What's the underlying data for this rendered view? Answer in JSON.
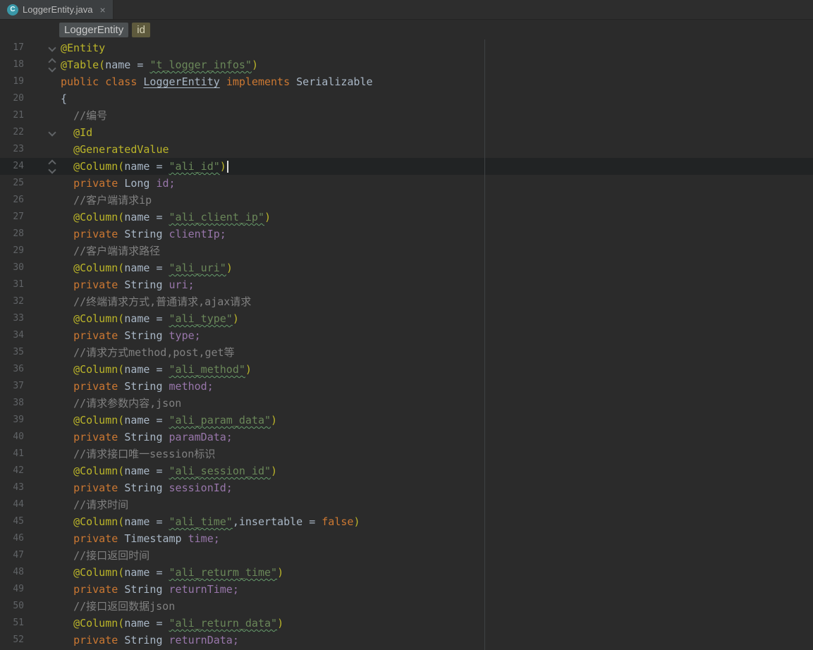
{
  "tab_bar": {
    "tabs": [
      {
        "title": "LoggerEntity.java",
        "icon": "java-class-icon",
        "icon_letter": "C",
        "close_glyph": "×",
        "active": true
      }
    ]
  },
  "breadcrumbs": {
    "items": [
      {
        "label": "LoggerEntity",
        "variant": "default"
      },
      {
        "label": "id",
        "variant": "highlight"
      }
    ]
  },
  "editor": {
    "language": "java",
    "current_line": 24,
    "margin_column_x": 687,
    "lines": [
      {
        "num": 17,
        "indent": 0,
        "fold": "chevron-down",
        "tokens": [
          [
            "ann",
            "@Entity"
          ]
        ]
      },
      {
        "num": 18,
        "indent": 0,
        "fold": "chevron-updown",
        "tokens": [
          [
            "ann",
            "@Table("
          ],
          [
            "plain",
            "name = "
          ],
          [
            "str",
            "\"t_logger_infos\""
          ],
          [
            "ann",
            ")"
          ]
        ]
      },
      {
        "num": 19,
        "indent": 0,
        "fold": null,
        "tokens": [
          [
            "kw",
            "public class "
          ],
          [
            "clsdecl",
            "LoggerEntity"
          ],
          [
            "plain",
            " "
          ],
          [
            "kw",
            "implements "
          ],
          [
            "plain",
            "Serializable"
          ]
        ]
      },
      {
        "num": 20,
        "indent": 0,
        "fold": null,
        "tokens": [
          [
            "plain",
            "{"
          ]
        ]
      },
      {
        "num": 21,
        "indent": 1,
        "fold": null,
        "tokens": [
          [
            "cmt",
            "//编号"
          ]
        ]
      },
      {
        "num": 22,
        "indent": 1,
        "fold": "chevron-down",
        "tokens": [
          [
            "ann",
            "@Id"
          ]
        ]
      },
      {
        "num": 23,
        "indent": 1,
        "fold": null,
        "tokens": [
          [
            "ann",
            "@GeneratedValue"
          ]
        ]
      },
      {
        "num": 24,
        "indent": 1,
        "fold": "chevron-updown",
        "caret": true,
        "tokens": [
          [
            "ann",
            "@Column("
          ],
          [
            "plain",
            "name = "
          ],
          [
            "str",
            "\"ali_id\""
          ],
          [
            "ann",
            ")"
          ]
        ]
      },
      {
        "num": 25,
        "indent": 1,
        "fold": null,
        "tokens": [
          [
            "kw",
            "private "
          ],
          [
            "plain",
            "Long "
          ],
          [
            "field",
            "id;"
          ]
        ]
      },
      {
        "num": 26,
        "indent": 1,
        "fold": null,
        "tokens": [
          [
            "cmt",
            "//客户端请求ip"
          ]
        ]
      },
      {
        "num": 27,
        "indent": 1,
        "fold": null,
        "tokens": [
          [
            "ann",
            "@Column("
          ],
          [
            "plain",
            "name = "
          ],
          [
            "str",
            "\"ali_client_ip\""
          ],
          [
            "ann",
            ")"
          ]
        ]
      },
      {
        "num": 28,
        "indent": 1,
        "fold": null,
        "tokens": [
          [
            "kw",
            "private "
          ],
          [
            "plain",
            "String "
          ],
          [
            "field",
            "clientIp;"
          ]
        ]
      },
      {
        "num": 29,
        "indent": 1,
        "fold": null,
        "tokens": [
          [
            "cmt",
            "//客户端请求路径"
          ]
        ]
      },
      {
        "num": 30,
        "indent": 1,
        "fold": null,
        "tokens": [
          [
            "ann",
            "@Column("
          ],
          [
            "plain",
            "name = "
          ],
          [
            "str",
            "\"ali_uri\""
          ],
          [
            "ann",
            ")"
          ]
        ]
      },
      {
        "num": 31,
        "indent": 1,
        "fold": null,
        "tokens": [
          [
            "kw",
            "private "
          ],
          [
            "plain",
            "String "
          ],
          [
            "field",
            "uri;"
          ]
        ]
      },
      {
        "num": 32,
        "indent": 1,
        "fold": null,
        "tokens": [
          [
            "cmt",
            "//终端请求方式,普通请求,ajax请求"
          ]
        ]
      },
      {
        "num": 33,
        "indent": 1,
        "fold": null,
        "tokens": [
          [
            "ann",
            "@Column("
          ],
          [
            "plain",
            "name = "
          ],
          [
            "str",
            "\"ali_type\""
          ],
          [
            "ann",
            ")"
          ]
        ]
      },
      {
        "num": 34,
        "indent": 1,
        "fold": null,
        "tokens": [
          [
            "kw",
            "private "
          ],
          [
            "plain",
            "String "
          ],
          [
            "field",
            "type;"
          ]
        ]
      },
      {
        "num": 35,
        "indent": 1,
        "fold": null,
        "tokens": [
          [
            "cmt",
            "//请求方式method,post,get等"
          ]
        ]
      },
      {
        "num": 36,
        "indent": 1,
        "fold": null,
        "tokens": [
          [
            "ann",
            "@Column("
          ],
          [
            "plain",
            "name = "
          ],
          [
            "str",
            "\"ali_method\""
          ],
          [
            "ann",
            ")"
          ]
        ]
      },
      {
        "num": 37,
        "indent": 1,
        "fold": null,
        "tokens": [
          [
            "kw",
            "private "
          ],
          [
            "plain",
            "String "
          ],
          [
            "field",
            "method;"
          ]
        ]
      },
      {
        "num": 38,
        "indent": 1,
        "fold": null,
        "tokens": [
          [
            "cmt",
            "//请求参数内容,json"
          ]
        ]
      },
      {
        "num": 39,
        "indent": 1,
        "fold": null,
        "tokens": [
          [
            "ann",
            "@Column("
          ],
          [
            "plain",
            "name = "
          ],
          [
            "str",
            "\"ali_param_data\""
          ],
          [
            "ann",
            ")"
          ]
        ]
      },
      {
        "num": 40,
        "indent": 1,
        "fold": null,
        "tokens": [
          [
            "kw",
            "private "
          ],
          [
            "plain",
            "String "
          ],
          [
            "field",
            "paramData;"
          ]
        ]
      },
      {
        "num": 41,
        "indent": 1,
        "fold": null,
        "tokens": [
          [
            "cmt",
            "//请求接口唯一session标识"
          ]
        ]
      },
      {
        "num": 42,
        "indent": 1,
        "fold": null,
        "tokens": [
          [
            "ann",
            "@Column("
          ],
          [
            "plain",
            "name = "
          ],
          [
            "str",
            "\"ali_session_id\""
          ],
          [
            "ann",
            ")"
          ]
        ]
      },
      {
        "num": 43,
        "indent": 1,
        "fold": null,
        "tokens": [
          [
            "kw",
            "private "
          ],
          [
            "plain",
            "String "
          ],
          [
            "field",
            "sessionId;"
          ]
        ]
      },
      {
        "num": 44,
        "indent": 1,
        "fold": null,
        "tokens": [
          [
            "cmt",
            "//请求时间"
          ]
        ]
      },
      {
        "num": 45,
        "indent": 1,
        "fold": null,
        "tokens": [
          [
            "ann",
            "@Column("
          ],
          [
            "plain",
            "name = "
          ],
          [
            "str",
            "\"ali_time\""
          ],
          [
            "plain",
            ",insertable = "
          ],
          [
            "kw",
            "false"
          ],
          [
            "ann",
            ")"
          ]
        ]
      },
      {
        "num": 46,
        "indent": 1,
        "fold": null,
        "tokens": [
          [
            "kw",
            "private "
          ],
          [
            "plain",
            "Timestamp "
          ],
          [
            "field",
            "time;"
          ]
        ]
      },
      {
        "num": 47,
        "indent": 1,
        "fold": null,
        "tokens": [
          [
            "cmt",
            "//接口返回时间"
          ]
        ]
      },
      {
        "num": 48,
        "indent": 1,
        "fold": null,
        "tokens": [
          [
            "ann",
            "@Column("
          ],
          [
            "plain",
            "name = "
          ],
          [
            "str",
            "\"ali_returm_time\""
          ],
          [
            "ann",
            ")"
          ]
        ]
      },
      {
        "num": 49,
        "indent": 1,
        "fold": null,
        "tokens": [
          [
            "kw",
            "private "
          ],
          [
            "plain",
            "String "
          ],
          [
            "field",
            "returnTime;"
          ]
        ]
      },
      {
        "num": 50,
        "indent": 1,
        "fold": null,
        "tokens": [
          [
            "cmt",
            "//接口返回数据json"
          ]
        ]
      },
      {
        "num": 51,
        "indent": 1,
        "fold": null,
        "tokens": [
          [
            "ann",
            "@Column("
          ],
          [
            "plain",
            "name = "
          ],
          [
            "str",
            "\"ali_return_data\""
          ],
          [
            "ann",
            ")"
          ]
        ]
      },
      {
        "num": 52,
        "indent": 1,
        "fold": null,
        "tokens": [
          [
            "kw",
            "private "
          ],
          [
            "plain",
            "String "
          ],
          [
            "field",
            "returnData;"
          ]
        ]
      }
    ]
  },
  "colors": {
    "background": "#2b2b2b",
    "tab_strip": "#2d2d2d",
    "tab_active": "#3c3f41",
    "current_line": "#212324",
    "annotation": "#bbb529",
    "keyword": "#cc7832",
    "string": "#6a8759",
    "comment": "#808080",
    "field": "#9876aa",
    "text": "#a9b7c6",
    "line_number": "#606366",
    "margin_line": "#3f4244",
    "typo_underline": "#659c6b",
    "caret": "#dcdcdc",
    "class_icon": "#3a98a8",
    "crumb_default_bg": "#4c5052",
    "crumb_highlight_bg": "#5e5a3d"
  }
}
